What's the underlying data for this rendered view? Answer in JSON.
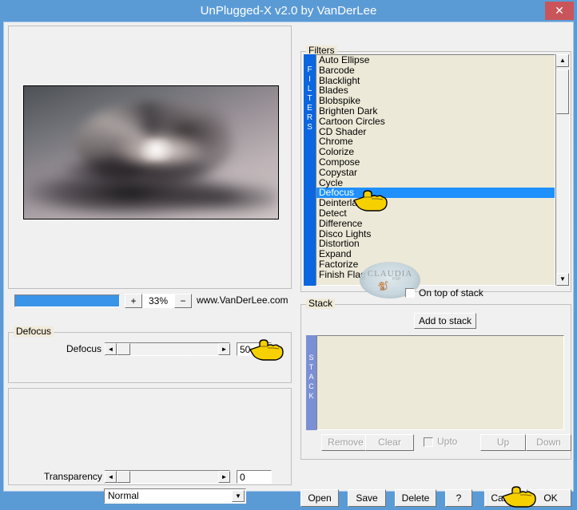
{
  "window": {
    "title": "UnPlugged-X v2.0 by VanDerLee",
    "close_label": "✕"
  },
  "preview": {
    "zoom_percent": "33%",
    "zoom_in_label": "+",
    "zoom_out_label": "−",
    "website": "www.VanDerLee.com",
    "progress_fill_percent": 100
  },
  "defocus_group": {
    "legend": "Defocus",
    "slider_label": "Defocus",
    "slider_value": "50",
    "left_arrow": "◄",
    "right_arrow": "►"
  },
  "transparency_group": {
    "label": "Transparency",
    "value": "0",
    "left_arrow": "◄",
    "right_arrow": "►",
    "blend_mode": "Normal",
    "blend_arrow": "▼"
  },
  "filters_group": {
    "legend": "Filters",
    "strip_text": "FILTERS",
    "selected": "Defocus",
    "items": [
      "Auto Ellipse",
      "Barcode",
      "Blacklight",
      "Blades",
      "Blobspike",
      "Brighten Dark",
      "Cartoon Circles",
      "CD Shader",
      "Chrome",
      "Colorize",
      "Compose",
      "Copystar",
      "Cycle",
      "Defocus",
      "Deinterlace",
      "Detect",
      "Difference",
      "Disco Lights",
      "Distortion",
      "Expand",
      "Factorize",
      "Finish Flag"
    ],
    "scroll_up": "▲",
    "scroll_down": "▼"
  },
  "on_top_of_stack": {
    "label": "On top of stack",
    "checked": false
  },
  "watermark": {
    "text": "CLAUDIA",
    "subtext": "PSP"
  },
  "stack_group": {
    "legend": "Stack",
    "add_label": "Add to stack",
    "strip_text": "STACK",
    "items": [],
    "buttons": [
      {
        "label": "Remove",
        "enabled": false
      },
      {
        "label": "Clear",
        "enabled": false
      },
      {
        "label": "Up",
        "enabled": false
      },
      {
        "label": "Down",
        "enabled": false
      }
    ],
    "upto_label": "Upto",
    "upto_checked": false
  },
  "bottom_buttons": [
    {
      "label": "Open"
    },
    {
      "label": "Save"
    },
    {
      "label": "Delete"
    },
    {
      "label": "?"
    },
    {
      "label": "Cancel"
    },
    {
      "label": "OK"
    }
  ],
  "colors": {
    "title_bar": "#5b9bd5",
    "close_button": "#c9555a",
    "selection": "#1e90ff",
    "filters_strip": "#0b66e0",
    "stack_strip": "#7b8fd4",
    "list_background": "#ece9d8",
    "progress_fill": "#3a95e8"
  }
}
